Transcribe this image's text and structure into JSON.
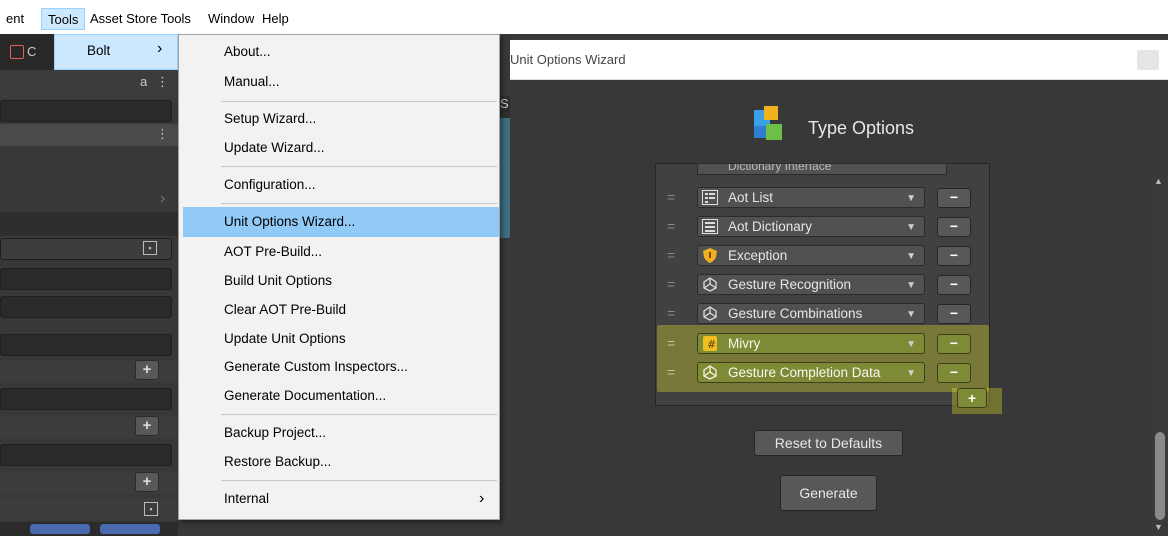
{
  "menubar": {
    "items": [
      "ent",
      "Tools",
      "Asset Store Tools",
      "Window",
      "Help"
    ]
  },
  "bolt_submenu": {
    "label": "Bolt",
    "arrow": "›"
  },
  "bolt_menu": {
    "group1": [
      "About...",
      "Manual..."
    ],
    "group2": [
      "Setup Wizard...",
      "Update Wizard..."
    ],
    "group3": [
      "Configuration..."
    ],
    "group4": [
      "Unit Options Wizard...",
      "AOT Pre-Build...",
      "Build Unit Options",
      "Clear AOT Pre-Build",
      "Update Unit Options",
      "Generate Custom Inspectors...",
      "Generate Documentation..."
    ],
    "group5": [
      "Backup Project...",
      "Restore Backup..."
    ],
    "internal": {
      "label": "Internal",
      "arrow": "›"
    },
    "highlighted": "Unit Options Wizard..."
  },
  "editor": {
    "top_label": "C",
    "plus": "+"
  },
  "wizard": {
    "window_title": "Unit Options Wizard",
    "heading": "Type Options",
    "partial_item": "Dictionary Interface",
    "types": [
      {
        "label": "Aot List",
        "icon": "list-icon"
      },
      {
        "label": "Aot Dictionary",
        "icon": "dictionary-icon"
      },
      {
        "label": "Exception",
        "icon": "shield-icon"
      },
      {
        "label": "Gesture Recognition",
        "icon": "gesture-icon"
      },
      {
        "label": "Gesture Combinations",
        "icon": "gesture-icon"
      },
      {
        "label": "Mivry",
        "icon": "script-icon"
      },
      {
        "label": "Gesture Completion Data",
        "icon": "gesture-icon"
      }
    ],
    "remove_symbol": "−",
    "add_symbol": "+",
    "reset_button": "Reset to Defaults",
    "generate_button": "Generate"
  },
  "colors": {
    "highlight": "#ebf028",
    "menu_select": "#91c9f7",
    "editor_bg": "#383838"
  }
}
